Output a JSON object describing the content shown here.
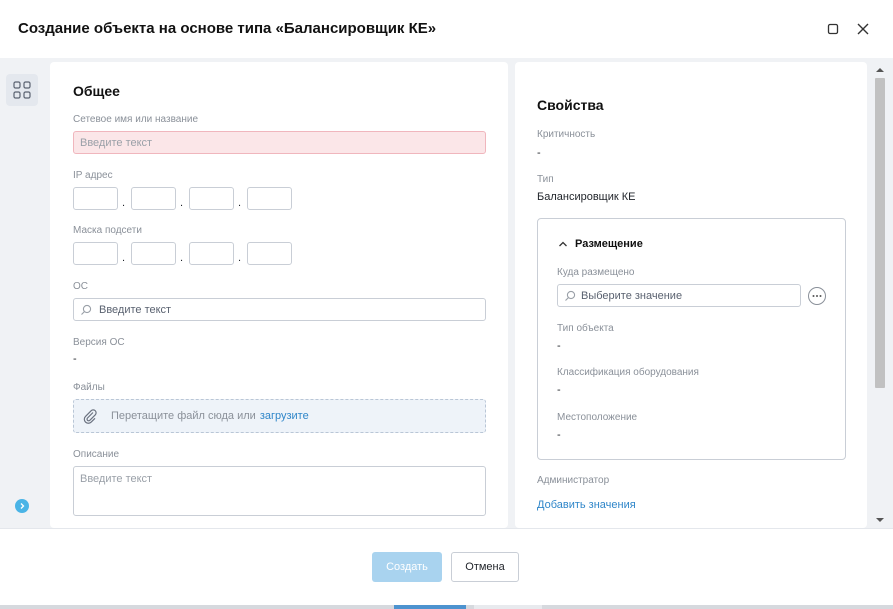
{
  "dialog": {
    "title": "Создание объекта на основе типа «Балансировщик КЕ»"
  },
  "general": {
    "section_title": "Общее",
    "network_name": {
      "label": "Сетевое имя или название",
      "placeholder": "Введите текст"
    },
    "ip": {
      "label": "IP адрес",
      "separator": "."
    },
    "mask": {
      "label": "Маска подсети",
      "separator": "."
    },
    "os": {
      "label": "ОС",
      "placeholder": "Введите текст"
    },
    "os_version": {
      "label": "Версия ОС",
      "value": "-"
    },
    "files": {
      "label": "Файлы",
      "hint": "Перетащите файл сюда или",
      "link": "загрузите"
    },
    "description": {
      "label": "Описание",
      "placeholder": "Введите текст"
    }
  },
  "properties": {
    "section_title": "Свойства",
    "criticality": {
      "label": "Критичность",
      "value": "-"
    },
    "type": {
      "label": "Тип",
      "value": "Балансировщик КЕ"
    },
    "placement": {
      "title": "Размещение",
      "location_field": {
        "label": "Куда размещено",
        "placeholder": "Выберите значение"
      },
      "object_type": {
        "label": "Тип объекта",
        "value": "-"
      },
      "classification": {
        "label": "Классификация оборудования",
        "value": "-"
      },
      "position": {
        "label": "Местоположение",
        "value": "-"
      }
    },
    "admin": {
      "label": "Администратор",
      "add_link": "Добавить значения"
    }
  },
  "footer": {
    "create_label": "Создать",
    "cancel_label": "Отмена"
  },
  "colors": {
    "accent": "#2f86c9",
    "primary_disabled": "#a9d3ef",
    "error_bg": "#fbe6e8"
  }
}
